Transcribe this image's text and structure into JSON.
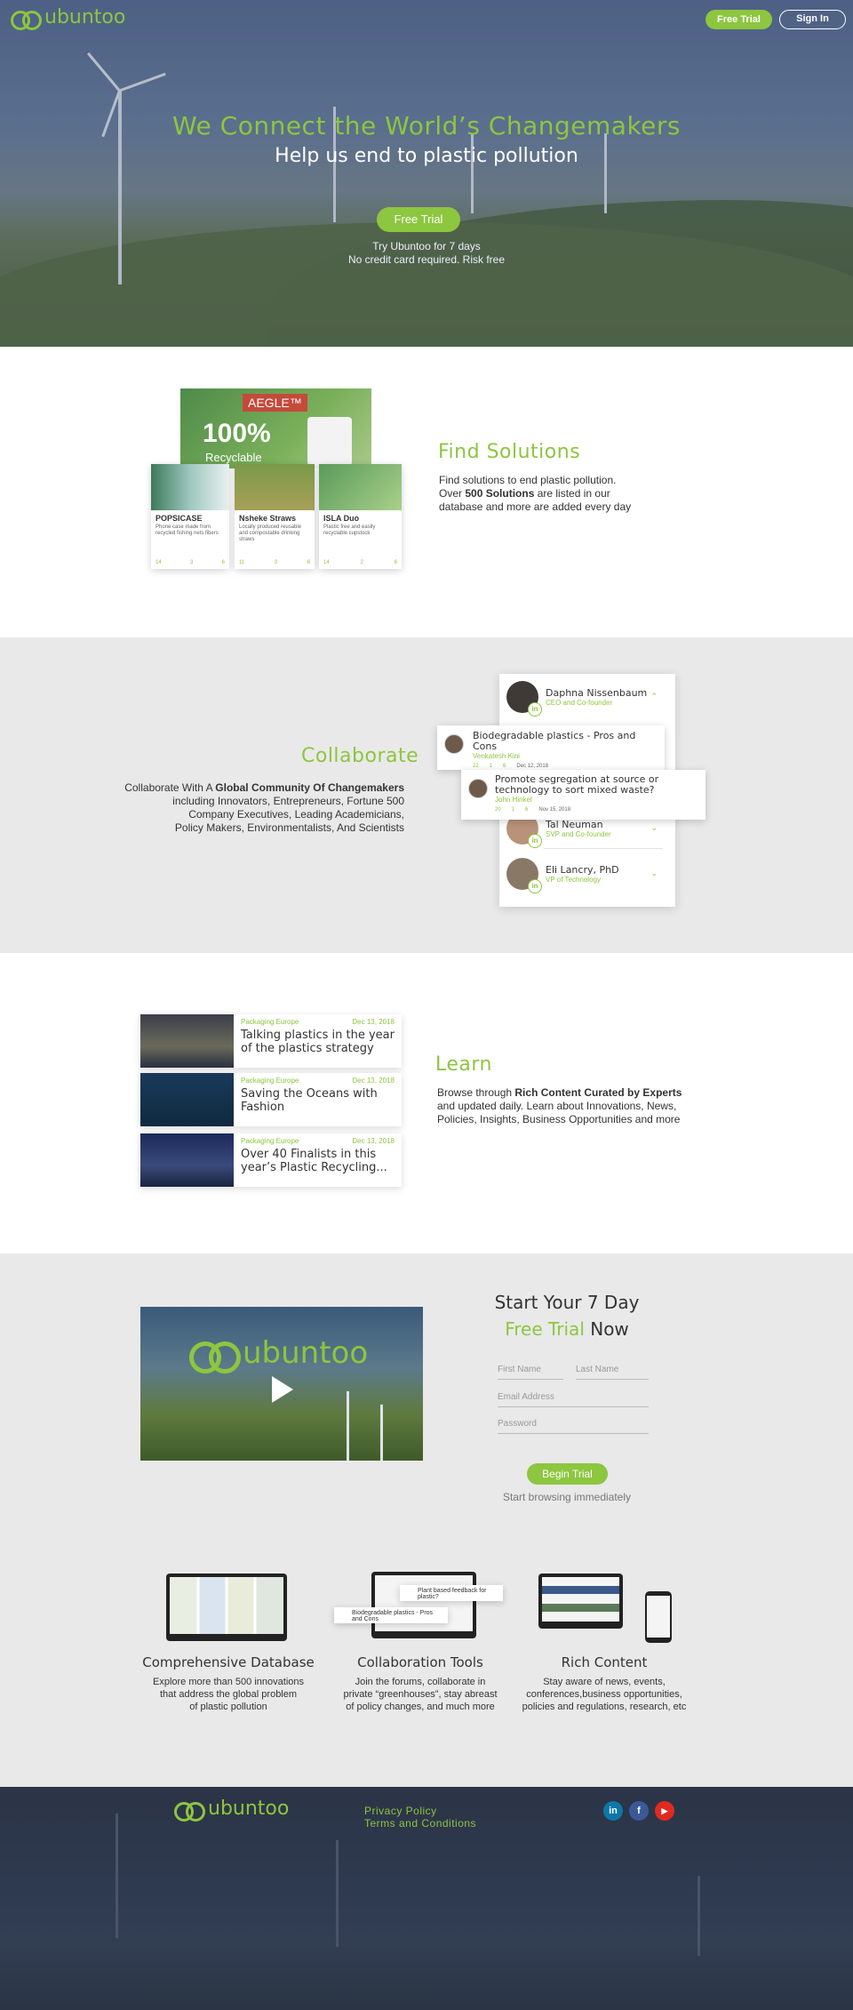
{
  "brand": {
    "name": "ubuntoo",
    "green": "#8dc63f"
  },
  "nav": {
    "free_trial": "Free Trial",
    "sign_in": "Sign In"
  },
  "hero": {
    "title": "We Connect the World’s Changemakers",
    "subtitle": "Help us end to plastic pollution",
    "cta": "Free Trial",
    "note_line1": "Try Ubuntoo for 7 days",
    "note_line2": "No credit card required. Risk free"
  },
  "solutions": {
    "title": "Find Solutions",
    "line1": "Find solutions to end plastic pollution.",
    "line2_pre": "Over ",
    "line2_bold": "500 Solutions",
    "line2_post": " are listed in our",
    "line3": "database and more are added every day",
    "banner": {
      "brand": "AEGLE™",
      "big": "100%",
      "small": "Recyclable"
    },
    "cards": [
      {
        "title": "POPSICASE",
        "desc": "Phone case made from recycled fishing nets fibers",
        "s1": "14",
        "s2": "3",
        "s3": "6"
      },
      {
        "title": "Nsheke Straws",
        "desc": "Locally produced reusable and compostable drinking straws",
        "s1": "11",
        "s2": "3",
        "s3": "6"
      },
      {
        "title": "ISLA Duo",
        "desc": "Plastic free and easily recyclable cupstock",
        "s1": "14",
        "s2": "2",
        "s3": "6"
      }
    ]
  },
  "collaborate": {
    "title": "Collaborate",
    "line1_pre": "Collaborate With A ",
    "line1_bold": "Global Community Of Changemakers",
    "line2": "including Innovators, Entrepreneurs, Fortune 500",
    "line3": "Company Executives, Leading Academicians,",
    "line4": "Policy Makers, Environmentalists, And Scientists",
    "people": [
      {
        "name": "Daphna Nissenbaum",
        "role": "CEO and Co-founder"
      },
      {
        "name": "Tal Neuman",
        "role": "SVP and Co-founder"
      },
      {
        "name": "Eli Lancry, PhD",
        "role": "VP of Technology"
      }
    ],
    "posts": [
      {
        "title": "Biodegradable plastics - Pros and Cons",
        "author": "Venkatesh Kini",
        "c": "22",
        "l": "1",
        "v": "6",
        "date": "Dec 12, 2018"
      },
      {
        "title": "Promote segregation at source or technology to sort mixed waste?",
        "author": "John Hinkel",
        "c": "20",
        "l": "1",
        "v": "6",
        "date": "Nov 15, 2018"
      }
    ],
    "badge": "in"
  },
  "learn": {
    "title": "Learn",
    "line1_pre": "Browse through ",
    "line1_bold": "Rich Content Curated by Experts",
    "line2": "and updated daily. Learn about Innovations, News,",
    "line3": "Policies, Insights, Business Opportunities and more",
    "news": [
      {
        "source": "Packaging Europe",
        "date": "Dec 13, 2018",
        "title": "Talking plastics in the year of the plastics strategy"
      },
      {
        "source": "Packaging Europe",
        "date": "Dec 13, 2018",
        "title": "Saving the Oceans with Fashion"
      },
      {
        "source": "Packaging Europe",
        "date": "Dec 13, 2018",
        "title": "Over 40 Finalists in this year’s Plastic Recycling..."
      }
    ]
  },
  "trial": {
    "line1": "Start Your 7 Day",
    "line2_green": "Free Trial",
    "line2_rest": " Now",
    "first_name": "First Name",
    "last_name": "Last Name",
    "email": "Email Address",
    "password": "Password",
    "cta": "Begin Trial",
    "note": "Start browsing immediately",
    "video_logo": "ubuntoo"
  },
  "features": [
    {
      "title": "Comprehensive Database",
      "l1": "Explore more than 500 innovations",
      "l2": "that address the global problem",
      "l3": "of plastic pollution"
    },
    {
      "title": "Collaboration Tools",
      "l1": "Join the forums, collaborate in",
      "l2": "private “greenhouses”, stay abreast",
      "l3": "of policy changes, and much more"
    },
    {
      "title": "Rich Content",
      "l1": "Stay aware of news, events,",
      "l2": "conferences,business opportunities,",
      "l3": "policies and regulations, research, etc"
    }
  ],
  "feature_mock": {
    "post1": "Plant based feedback for plastic?",
    "post2": "Biodegradable plastics - Pros and Cons"
  },
  "footer": {
    "logo": "ubuntoo",
    "privacy": "Privacy Policy",
    "terms": "Terms and Conditions",
    "social": {
      "linkedin": "in",
      "facebook": "f",
      "youtube": "▶"
    }
  }
}
